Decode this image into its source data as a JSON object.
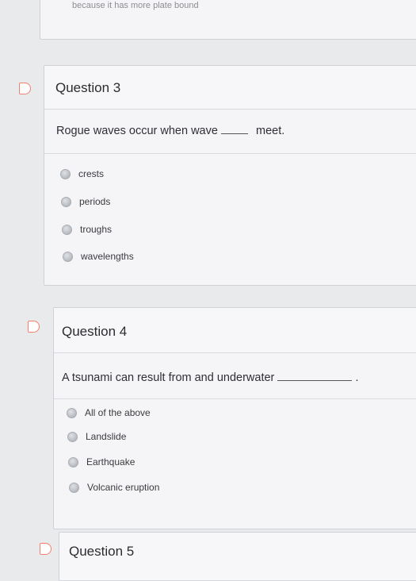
{
  "previous_card": {
    "cut_text": "because it has more plate bound"
  },
  "q3": {
    "title": "Question 3",
    "prompt_before": "Rogue waves occur when wave",
    "prompt_after": "meet.",
    "options": [
      "crests",
      "periods",
      "troughs",
      "wavelengths"
    ]
  },
  "q4": {
    "title": "Question 4",
    "prompt_before": "A tsunami can result from and underwater",
    "prompt_after": ".",
    "options": [
      "All of the above",
      "Landslide",
      "Earthquake",
      "Volcanic eruption"
    ]
  },
  "q5": {
    "title": "Question 5"
  },
  "colors": {
    "flag": "#f27f6c",
    "card_bg": "#f5f5f7",
    "page_bg": "#e9eaec"
  }
}
